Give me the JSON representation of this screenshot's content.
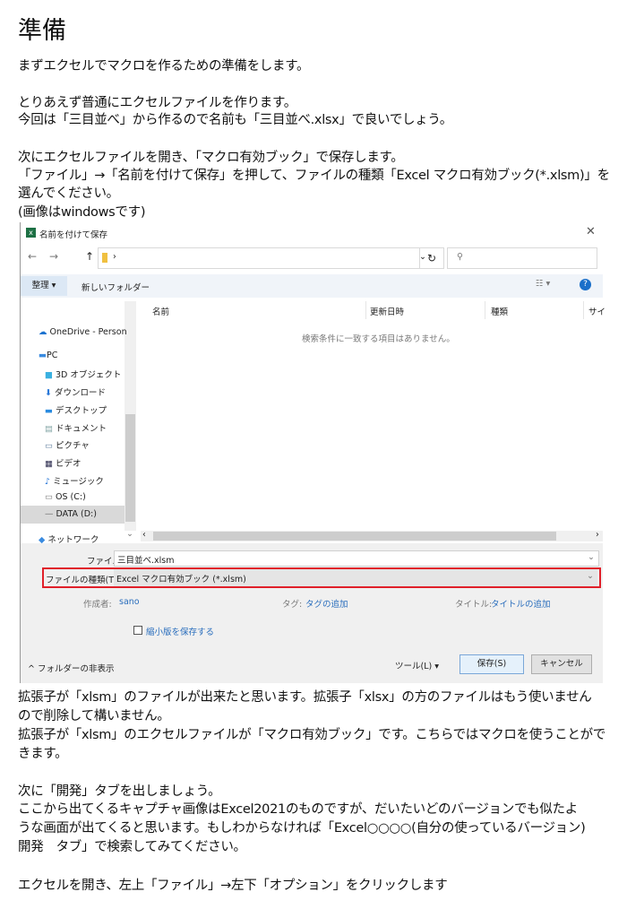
{
  "heading": "準備",
  "paragraphs": [
    "まずエクセルでマクロを作るための準備をします。",
    "とりあえず普通にエクセルファイルを作ります。",
    "今回は「三目並べ」から作るので名前も「三目並べ.xlsx」で良いでしょう。",
    "次にエクセルファイルを開き、「マクロ有効ブック」で保存します。",
    "「ファイル」→「名前を付けて保存」を押して、ファイルの種類「Excel マクロ有効ブック(*.xlsm)」を",
    "選んでください。",
    "(画像はwindowsです)",
    "拡張子が「xlsm」のファイルが出来たと思います。拡張子「xlsx」の方のファイルはもう使いません",
    "ので削除して構いません。",
    "拡張子が「xlsm」のエクセルファイルが「マクロ有効ブック」です。こちらではマクロを使うことがで",
    "きます。",
    "次に「開発」タブを出しましょう。",
    "ここから出てくるキャプチャ画像はExcel2021のものですが、だいたいどのバージョンでも似たよ",
    "うな画面が出てくると思います。もしわからなければ「Excel○○○○(自分の使っているバージョン)",
    "開発　タブ」で検索してみてください。",
    "エクセルを開き、左上「ファイル」→左下「オプション」をクリックします"
  ],
  "dialog": {
    "title": "名前を付けて保存",
    "organize": "整理 ▾",
    "new_folder": "新しいフォルダー",
    "columns": [
      "名前",
      "更新日時",
      "種類",
      "サイ"
    ],
    "empty_message": "検索条件に一致する項目はありません。",
    "nav": [
      "OneDrive - Person",
      "PC",
      "3D オブジェクト",
      "ダウンロード",
      "デスクトップ",
      "ドキュメント",
      "ピクチャ",
      "ビデオ",
      "ミュージック",
      "OS (C:)",
      "DATA (D:)",
      "ネットワーク"
    ],
    "filename_label": "ファイル名(N):",
    "filename_value": "三目並べ.xlsm",
    "filetype_label": "ファイルの種類(T):",
    "filetype_value": "Excel マクロ有効ブック (*.xlsm)",
    "author_label": "作成者:",
    "author_value": "sano",
    "tags_label": "タグ:",
    "tags_value": "タグの追加",
    "title_label": "タイトル:",
    "title_value": "タイトルの追加",
    "thumbnail_label": "縮小版を保存する",
    "hide_folders": "フォルダーの非表示",
    "tools": "ツール(L)",
    "save": "保存(S)",
    "cancel": "キャンセル",
    "highlight_color": "#e0202a"
  }
}
